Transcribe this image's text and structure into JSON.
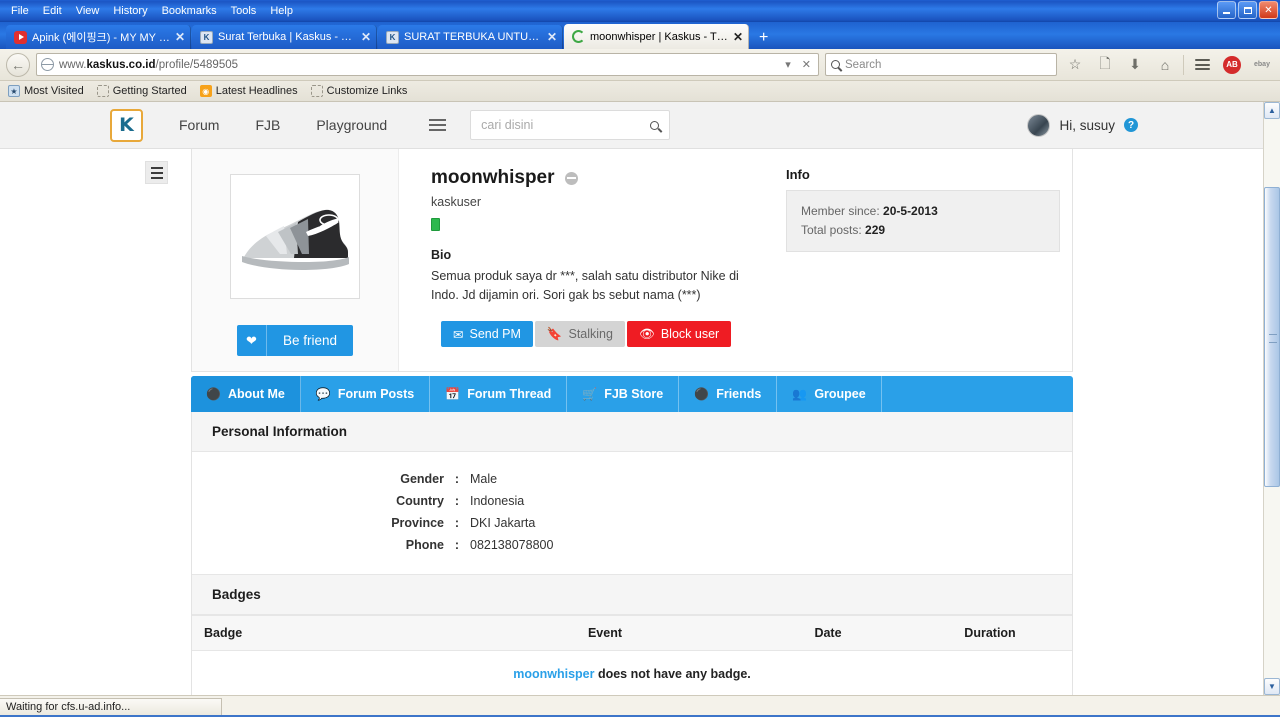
{
  "window": {
    "menus": [
      "File",
      "Edit",
      "View",
      "History",
      "Bookmarks",
      "Tools",
      "Help"
    ],
    "controls": {
      "minimize": "minimize-icon",
      "maximize": "maximize-icon",
      "close": "✕"
    }
  },
  "browser": {
    "tabs": [
      {
        "title": "Apink (에이핑크) - MY MY - Y...",
        "favicon": "youtube-icon",
        "active": false,
        "close": "✕"
      },
      {
        "title": "Surat Terbuka | Kaskus - The ...",
        "favicon": "kaskus-icon",
        "active": false,
        "close": "✕"
      },
      {
        "title": "SURAT TERBUKA UNTUK ID M...",
        "favicon": "kaskus-icon",
        "active": false,
        "close": "✕"
      },
      {
        "title": "moonwhisper | Kaskus - The L...",
        "favicon": "loading-spinner-icon",
        "active": true,
        "close": "✕"
      }
    ],
    "new_tab_label": "+",
    "back_icon": "←",
    "url_prefix": "www.",
    "url_domain": "kaskus.co.id",
    "url_path": "/profile/5489505",
    "url_dropdown": "▾",
    "url_stop": "✕",
    "search_placeholder": "Search",
    "toolbar_icons": [
      "bookmark-star-icon",
      "reader-list-icon",
      "downloads-icon",
      "home-icon",
      "menu-hamburger-icon",
      "adblock-extension-icon",
      "ebay-extension-icon"
    ],
    "bookmarks": [
      {
        "label": "Most Visited",
        "icon": "most-visited-icon"
      },
      {
        "label": "Getting Started",
        "icon": "getting-started-icon"
      },
      {
        "label": "Latest Headlines",
        "icon": "rss-feed-icon"
      },
      {
        "label": "Customize Links",
        "icon": "customize-links-icon"
      }
    ],
    "status_text": "Waiting for cfs.u-ad.info..."
  },
  "site": {
    "logo_text": "K",
    "nav": [
      "Forum",
      "FJB",
      "Playground"
    ],
    "search_placeholder": "cari disini",
    "search_icon": "search-icon",
    "greeting": "Hi, susuy",
    "help_badge": "?"
  },
  "profile": {
    "username": "moonwhisper",
    "role": "kaskuser",
    "status": "offline",
    "bio_title": "Bio",
    "bio_text": "Semua produk saya dr ***, salah satu distributor Nike di Indo. Jd dijamin ori. Sori gak bs sebut nama (***)",
    "befriend_label": "Be friend",
    "befriend_icon": "heart-icon",
    "actions": [
      {
        "label": "Send PM",
        "icon": "envelope-icon",
        "style": "primary"
      },
      {
        "label": "Stalking",
        "icon": "bookmark-icon",
        "style": "muted"
      },
      {
        "label": "Block user",
        "icon": "eye-slash-icon",
        "style": "danger"
      }
    ],
    "info": {
      "title": "Info",
      "member_since_label": "Member since:",
      "member_since_value": "20-5-2013",
      "total_posts_label": "Total posts:",
      "total_posts_value": "229"
    },
    "tabs": [
      {
        "label": "About Me",
        "icon": "user-pin-icon",
        "active": true
      },
      {
        "label": "Forum Posts",
        "icon": "comment-icon",
        "active": false
      },
      {
        "label": "Forum Thread",
        "icon": "calendar-icon",
        "active": false
      },
      {
        "label": "FJB Store",
        "icon": "cart-icon",
        "active": false
      },
      {
        "label": "Friends",
        "icon": "user-pin-icon",
        "active": false
      },
      {
        "label": "Groupee",
        "icon": "group-icon",
        "active": false
      }
    ],
    "personal_information": {
      "title": "Personal Information",
      "rows": [
        {
          "label": "Gender",
          "value": "Male"
        },
        {
          "label": "Country",
          "value": "Indonesia"
        },
        {
          "label": "Province",
          "value": "DKI Jakarta"
        },
        {
          "label": "Phone",
          "value": "082138078800"
        }
      ],
      "colon": ":"
    },
    "badges": {
      "title": "Badges",
      "columns": [
        "Badge",
        "Event",
        "Date",
        "Duration"
      ],
      "empty_user": "moonwhisper",
      "empty_message": " does not have any badge."
    }
  },
  "colors": {
    "kaskus_blue": "#2aa0e8",
    "action_blue": "#2196e3",
    "danger_red": "#ef1c23",
    "chrome_blue": "#2a78e4"
  }
}
